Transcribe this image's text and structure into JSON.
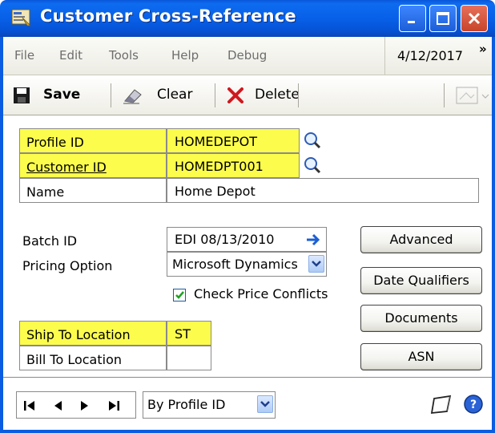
{
  "window": {
    "title": "Customer Cross-Reference"
  },
  "menu": {
    "file": "File",
    "edit": "Edit",
    "tools": "Tools",
    "help": "Help",
    "debug": "Debug",
    "date": "4/12/2017",
    "more_glyph": "»"
  },
  "toolbar": {
    "save_label": "Save",
    "clear_label": "Clear",
    "delete_label": "Delete"
  },
  "form": {
    "profile_id_label": "Profile ID",
    "profile_id_value": "HOMEDEPOT",
    "customer_id_label": "Customer ID",
    "customer_id_value": "HOMEDPT001",
    "name_label": "Name",
    "name_value": "Home Depot",
    "batch_id_label": "Batch ID",
    "batch_id_value": "EDI 08/13/2010",
    "pricing_option_label": "Pricing Option",
    "pricing_option_value": "Microsoft Dynamics",
    "check_price_conflicts_label": "Check Price Conflicts",
    "check_price_conflicts_checked": true,
    "ship_to_label": "Ship To Location",
    "ship_to_value": "ST",
    "bill_to_label": "Bill To Location",
    "bill_to_value": ""
  },
  "buttons": {
    "advanced": "Advanced",
    "date_qualifiers": "Date Qualifiers",
    "documents": "Documents",
    "asn": "ASN"
  },
  "bottom": {
    "sort_value": "By Profile ID"
  },
  "colors": {
    "highlight": "#fcfc4d",
    "titlebar": "#0860e8",
    "close_button": "#c7442a"
  },
  "icons": {
    "app": "app-icon",
    "save": "floppy-disk-icon",
    "clear": "eraser-icon",
    "delete": "red-x-icon",
    "lookup": "magnifier-icon",
    "expand": "blue-arrow-icon",
    "note": "note-icon",
    "help": "help-icon"
  }
}
